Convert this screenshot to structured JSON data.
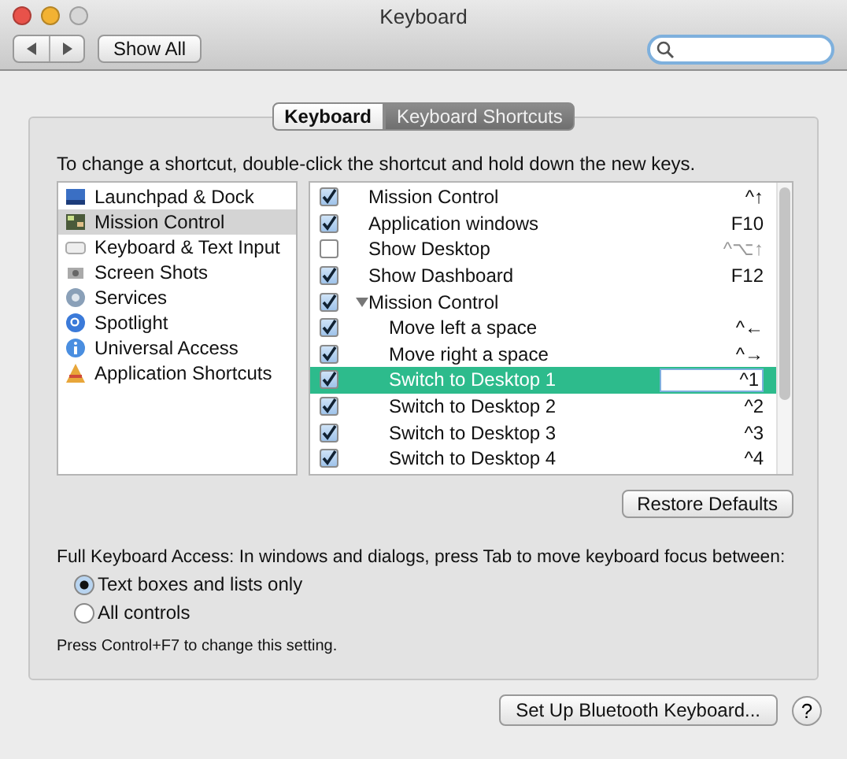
{
  "window": {
    "title": "Keyboard"
  },
  "toolbar": {
    "show_all": "Show All"
  },
  "tabs": [
    {
      "label": "Keyboard",
      "selected": false
    },
    {
      "label": "Keyboard Shortcuts",
      "selected": true
    }
  ],
  "instruction": "To change a shortcut, double-click the shortcut and hold down the new keys.",
  "categories": [
    {
      "label": "Launchpad & Dock",
      "selected": false
    },
    {
      "label": "Mission Control",
      "selected": true
    },
    {
      "label": "Keyboard & Text Input",
      "selected": false
    },
    {
      "label": "Screen Shots",
      "selected": false
    },
    {
      "label": "Services",
      "selected": false
    },
    {
      "label": "Spotlight",
      "selected": false
    },
    {
      "label": "Universal Access",
      "selected": false
    },
    {
      "label": "Application Shortcuts",
      "selected": false
    }
  ],
  "shortcuts": [
    {
      "name": "Mission Control",
      "keys": "^↑",
      "checked": true,
      "selected": false
    },
    {
      "name": "Application windows",
      "keys": "F10",
      "checked": true,
      "selected": false
    },
    {
      "name": "Show Desktop",
      "keys": "^⌥↑",
      "checked": false,
      "selected": false
    },
    {
      "name": "Show Dashboard",
      "keys": "F12",
      "checked": true,
      "selected": false
    },
    {
      "name": "Mission Control",
      "checked": true,
      "selected": false,
      "expanded": true,
      "children": [
        {
          "name": "Move left a space",
          "keys": "^←",
          "checked": true,
          "selected": false
        },
        {
          "name": "Move right a space",
          "keys": "^→",
          "checked": true,
          "selected": false
        },
        {
          "name": "Switch to Desktop 1",
          "keys": "^1",
          "checked": true,
          "selected": true
        },
        {
          "name": "Switch to Desktop 2",
          "keys": "^2",
          "checked": true,
          "selected": false
        },
        {
          "name": "Switch to Desktop 3",
          "keys": "^3",
          "checked": true,
          "selected": false
        },
        {
          "name": "Switch to Desktop 4",
          "keys": "^4",
          "checked": true,
          "selected": false
        }
      ]
    }
  ],
  "restore_defaults": "Restore Defaults",
  "full_keyboard_access": {
    "label": "Full Keyboard Access: In windows and dialogs, press Tab to move keyboard focus between:",
    "options": [
      {
        "label": "Text boxes and lists only",
        "selected": true
      },
      {
        "label": "All controls",
        "selected": false
      }
    ],
    "note": "Press Control+F7 to change this setting."
  },
  "bluetooth_button": "Set Up Bluetooth Keyboard...",
  "help": "?"
}
